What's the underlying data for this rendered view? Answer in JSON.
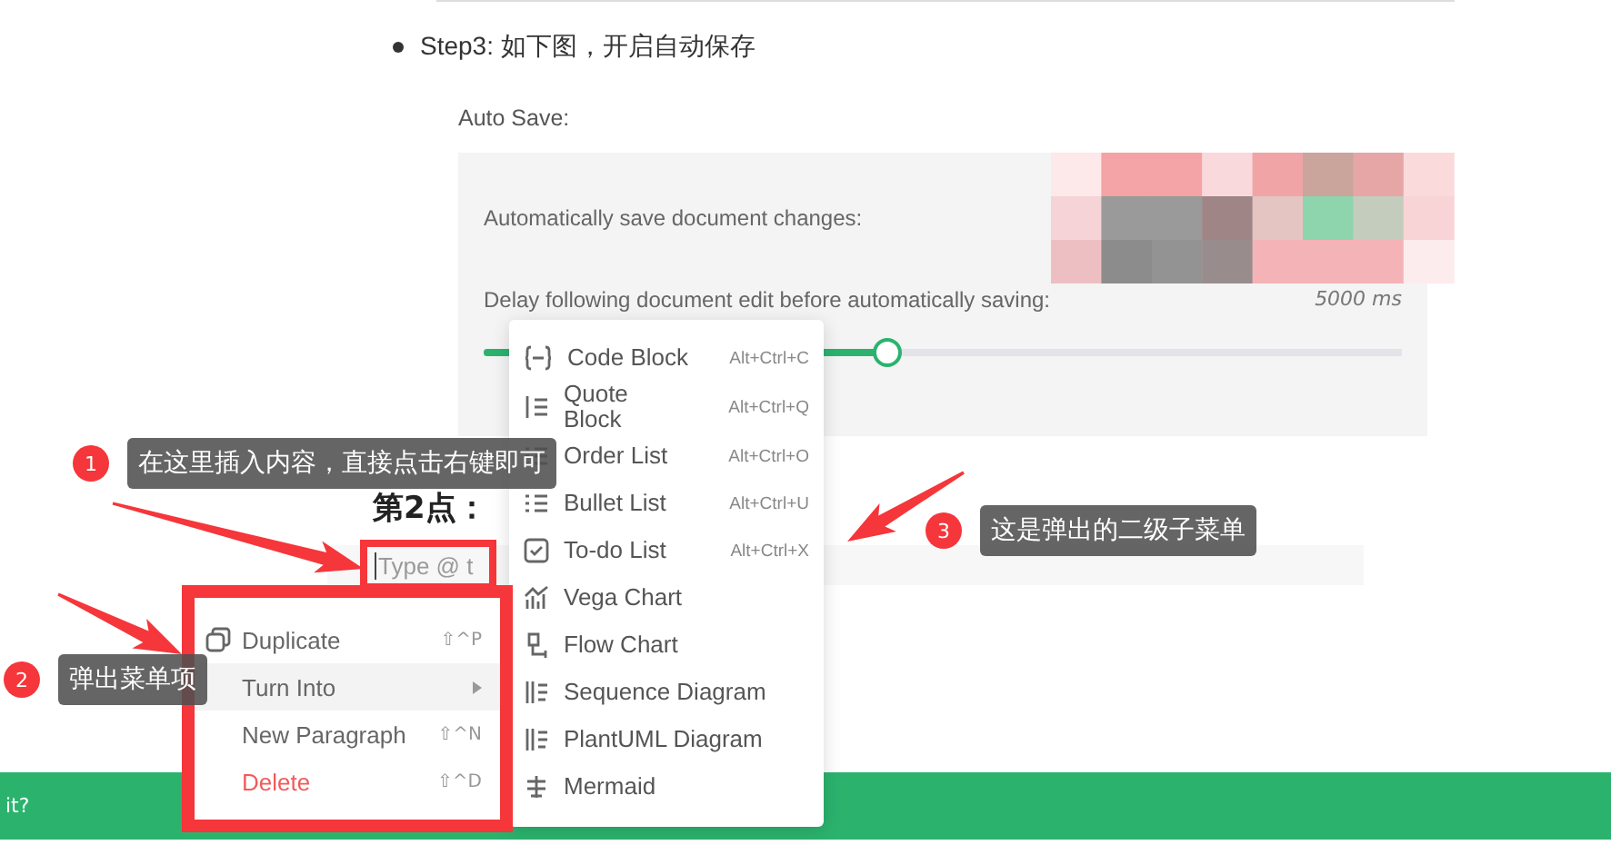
{
  "article": {
    "step": "Step3: 如下图，开启自动保存"
  },
  "settings": {
    "title": "Auto Save:",
    "auto_save_label": "Automatically save document changes:",
    "delay_label": "Delay following document edit before automatically saving:",
    "delay_value": "5000 ms",
    "slider": {
      "level": 0.44
    }
  },
  "editor": {
    "heading": "第2点：",
    "placeholder": "Type @ t"
  },
  "submenu": {
    "items": [
      {
        "label": "Code Block",
        "shortcut": "Alt+Ctrl+C"
      },
      {
        "label": "Quote Block",
        "shortcut": "Alt+Ctrl+Q"
      },
      {
        "label": "Order List",
        "shortcut": "Alt+Ctrl+O"
      },
      {
        "label": "Bullet List",
        "shortcut": "Alt+Ctrl+U"
      },
      {
        "label": "To-do List",
        "shortcut": "Alt+Ctrl+X"
      },
      {
        "label": "Vega Chart"
      },
      {
        "label": "Flow Chart"
      },
      {
        "label": "Sequence Diagram"
      },
      {
        "label": "PlantUML Diagram"
      },
      {
        "label": "Mermaid"
      }
    ]
  },
  "context_menu": {
    "items": [
      {
        "kind": "normal",
        "label": "Duplicate",
        "shortcut": "⇧^P",
        "selected": false
      },
      {
        "kind": "submenu",
        "label": "Turn Into",
        "selected": true
      },
      {
        "kind": "normal",
        "label": "New Paragraph",
        "shortcut": "⇧^N",
        "selected": false
      },
      {
        "kind": "danger",
        "label": "Delete",
        "shortcut": "⇧^D",
        "selected": false
      }
    ]
  },
  "callouts": [
    {
      "number": "1",
      "text": "在这里插入内容，直接点击右键即可"
    },
    {
      "number": "2",
      "text": "弹出菜单项"
    },
    {
      "number": "3",
      "text": "这是弹出的二级子菜单"
    }
  ],
  "footer": {
    "text": "it?"
  }
}
